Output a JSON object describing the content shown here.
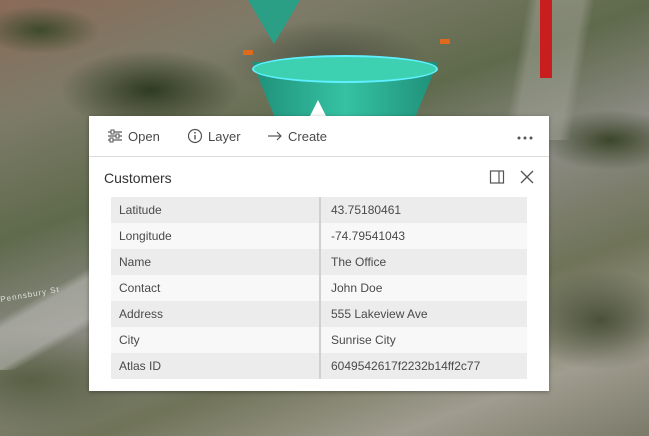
{
  "map": {
    "street_label": "Pennsbury St"
  },
  "toolbar": {
    "open_label": "Open",
    "layer_label": "Layer",
    "create_label": "Create",
    "more_icon": "ellipsis-icon"
  },
  "popup": {
    "title": "Customers",
    "rows": [
      {
        "label": "Latitude",
        "value": "43.75180461"
      },
      {
        "label": "Longitude",
        "value": "-74.79541043"
      },
      {
        "label": "Name",
        "value": "The Office"
      },
      {
        "label": "Contact",
        "value": "John Doe"
      },
      {
        "label": "Address",
        "value": "555 Lakeview Ave"
      },
      {
        "label": "City",
        "value": "Sunrise City"
      },
      {
        "label": "Atlas ID",
        "value": "6049542617f2232b14ff2c77"
      }
    ]
  },
  "colors": {
    "feature_fill": "#2a9f86",
    "selection_outline": "#5ff0ff",
    "pole": "#c81e1e"
  }
}
